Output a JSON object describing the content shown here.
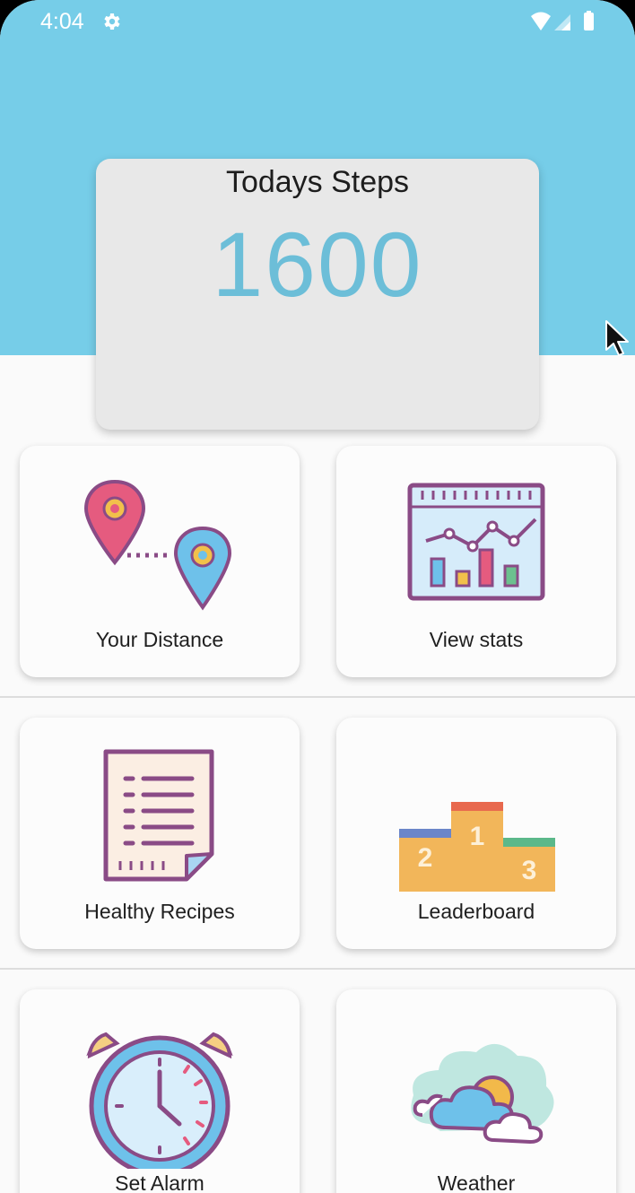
{
  "status_bar": {
    "time": "4:04",
    "icons": [
      "gear-icon",
      "wifi-icon",
      "signal-icon",
      "battery-icon"
    ]
  },
  "header": {
    "background_color": "#76cde8"
  },
  "steps_card": {
    "title": "Todays Steps",
    "value": "1600",
    "value_color": "#6cbed8"
  },
  "tiles": [
    {
      "label": "Your Distance",
      "icon": "map-pins-icon"
    },
    {
      "label": "View stats",
      "icon": "stats-chart-icon"
    },
    {
      "label": "Healthy Recipes",
      "icon": "recipe-document-icon"
    },
    {
      "label": "Leaderboard",
      "icon": "podium-icon"
    },
    {
      "label": "Set Alarm",
      "icon": "alarm-clock-icon"
    },
    {
      "label": "Weather",
      "icon": "weather-cloud-icon"
    }
  ]
}
